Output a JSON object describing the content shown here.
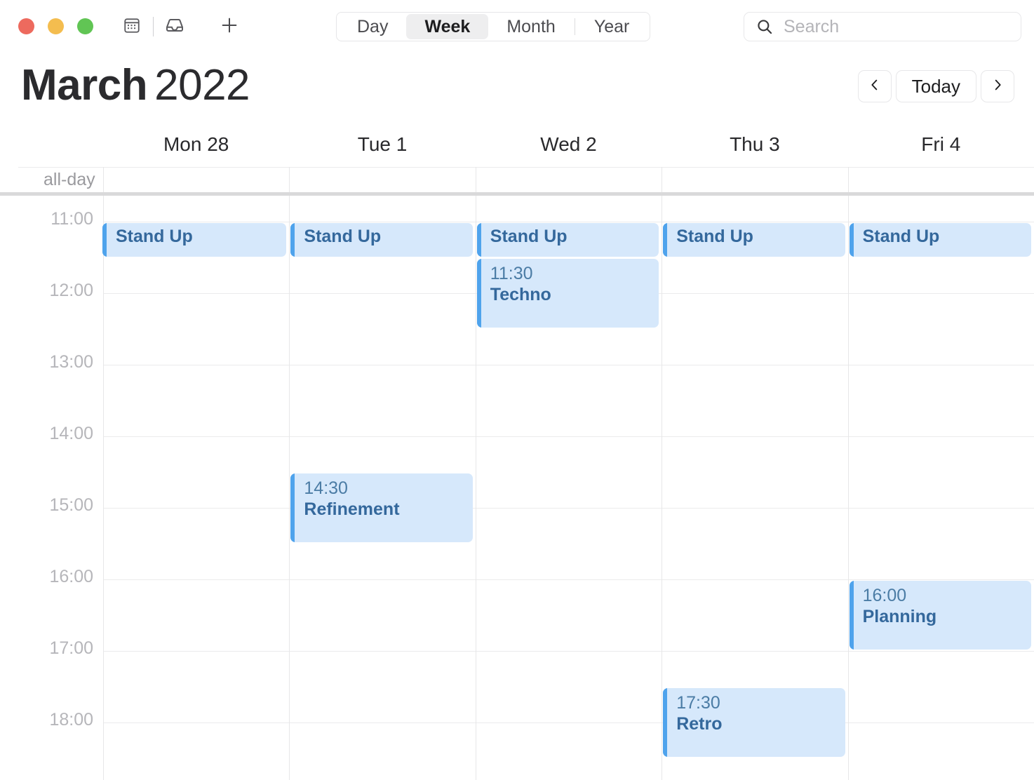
{
  "window": {
    "traffic_lights": [
      {
        "name": "close",
        "color": "#ed6a5e"
      },
      {
        "name": "minimize",
        "color": "#f4bd4f"
      },
      {
        "name": "maximize",
        "color": "#61c554"
      }
    ]
  },
  "toolbar": {
    "calendar_icon": "calendar-icon",
    "inbox_icon": "inbox-icon",
    "add_icon": "plus-icon",
    "views": [
      {
        "label": "Day",
        "active": false
      },
      {
        "label": "Week",
        "active": true
      },
      {
        "label": "Month",
        "active": false
      },
      {
        "label": "Year",
        "active": false
      }
    ]
  },
  "search": {
    "icon": "search-icon",
    "placeholder": "Search",
    "value": ""
  },
  "header": {
    "month": "March",
    "year": "2022",
    "prev_label": "‹",
    "today_label": "Today",
    "next_label": "›"
  },
  "calendar": {
    "allday_label": "all-day",
    "days": [
      {
        "label": "Mon 28"
      },
      {
        "label": "Tue 1"
      },
      {
        "label": "Wed 2"
      },
      {
        "label": "Thu 3"
      },
      {
        "label": "Fri 4"
      }
    ],
    "hours": [
      "11:00",
      "12:00",
      "13:00",
      "14:00",
      "15:00",
      "16:00",
      "17:00",
      "18:00"
    ],
    "events": [
      {
        "day": 0,
        "time": "11:00",
        "title": "Stand Up",
        "show_time": false
      },
      {
        "day": 1,
        "time": "11:00",
        "title": "Stand Up",
        "show_time": false
      },
      {
        "day": 2,
        "time": "11:00",
        "title": "Stand Up",
        "show_time": false
      },
      {
        "day": 3,
        "time": "11:00",
        "title": "Stand Up",
        "show_time": false
      },
      {
        "day": 4,
        "time": "11:00",
        "title": "Stand Up",
        "show_time": false
      },
      {
        "day": 2,
        "time": "11:30",
        "title": "Techno",
        "show_time": true
      },
      {
        "day": 1,
        "time": "14:30",
        "title": "Refinement",
        "show_time": true
      },
      {
        "day": 4,
        "time": "16:00",
        "title": "Planning",
        "show_time": true
      },
      {
        "day": 3,
        "time": "17:30",
        "title": "Retro",
        "show_time": true
      }
    ]
  },
  "colors": {
    "event_fill": "#d6e8fb",
    "event_accent": "#4fa3ec",
    "event_title": "#34689c",
    "event_time": "#4b7ca5"
  }
}
